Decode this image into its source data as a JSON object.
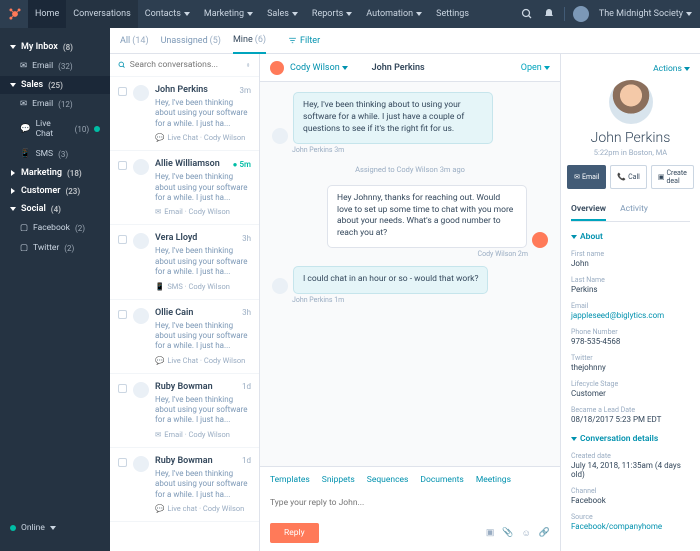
{
  "nav": {
    "home": "Home",
    "conversations": "Conversations",
    "contacts": "Contacts",
    "marketing": "Marketing",
    "sales": "Sales",
    "reports": "Reports",
    "automation": "Automation",
    "settings": "Settings",
    "account": "The Midnight Society"
  },
  "sidebar": {
    "inbox": {
      "label": "My Inbox",
      "count": "(8)",
      "email": {
        "label": "Email",
        "count": "(32)"
      }
    },
    "sales": {
      "label": "Sales",
      "count": "(25)",
      "email": {
        "label": "Email",
        "count": "(12)"
      },
      "chat": {
        "label": "Live Chat",
        "count": "(10)"
      },
      "sms": {
        "label": "SMS",
        "count": "(3)"
      }
    },
    "marketing": {
      "label": "Marketing",
      "count": "(18)"
    },
    "customer": {
      "label": "Customer",
      "count": "(23)"
    },
    "social": {
      "label": "Social",
      "count": "(4)",
      "fb": {
        "label": "Facebook",
        "count": "(2)"
      },
      "tw": {
        "label": "Twitter",
        "count": "(2)"
      }
    },
    "online": "Online"
  },
  "tabs": {
    "all": "All",
    "all_n": "(14)",
    "unassigned": "Unassigned",
    "unassigned_n": "(5)",
    "mine": "Mine",
    "mine_n": "(6)",
    "filter": "Filter"
  },
  "search": {
    "placeholder": "Search conversations..."
  },
  "list": [
    {
      "name": "John Perkins",
      "time": "3m",
      "snip": "Hey, I've been thinking about using your software for a while. I just ha...",
      "src": "Live Chat · Cody Wilson",
      "icon": "chat"
    },
    {
      "name": "Allie Williamson",
      "time": "5m",
      "new": true,
      "snip": "Hey, I've been thinking about using your software for a while. I just ha...",
      "src": "Email · Cody Wilson",
      "icon": "email"
    },
    {
      "name": "Vera Lloyd",
      "time": "3h",
      "snip": "Hey, I've been thinking about using your software for a while. I just ha...",
      "src": "SMS · Cody Wilson",
      "icon": "sms"
    },
    {
      "name": "Ollie Cain",
      "time": "3h",
      "snip": "Hey, I've been thinking about using your software for a while. I just ha...",
      "src": "Live Chat · Cody Wilson",
      "icon": "chat"
    },
    {
      "name": "Ruby Bowman",
      "time": "1d",
      "snip": "Hey, I've been thinking about using your software for a while. I just ha...",
      "src": "Email · Cody Wilson",
      "icon": "email"
    },
    {
      "name": "Ruby Bowman",
      "time": "1d",
      "snip": "Hey, I've been thinking about using your software for a while. I just ha...",
      "src": "Live chat · Cody Wilson",
      "icon": "chat"
    }
  ],
  "thread": {
    "assignee": "Cody Wilson",
    "contact": "John Perkins",
    "status": "Open",
    "msgs": [
      {
        "dir": "in",
        "text": "Hey, I've been thinking about to using your software for a while. I just have a couple of questions to see if it's the right fit for us.",
        "meta": "John Perkins 3m"
      },
      {
        "sys": "Assigned to Cody Wilson 3m ago"
      },
      {
        "dir": "out",
        "text": "Hey Johnny, thanks for reaching out. Would love to set up some time to chat with you more about your needs. What's a good number to reach you at?",
        "meta": "Cody Wilson 2m"
      },
      {
        "dir": "in",
        "text": "I could chat in an hour or so - would that work?",
        "meta": "John Perkins 1m"
      }
    ],
    "reply": {
      "templates": "Templates",
      "snippets": "Snippets",
      "sequences": "Sequences",
      "documents": "Documents",
      "meetings": "Meetings",
      "placeholder": "Type your reply to John...",
      "button": "Reply"
    }
  },
  "detail": {
    "actions": "Actions",
    "name": "John Perkins",
    "sub": "5:22pm in Boston, MA",
    "btns": {
      "email": "Email",
      "call": "Call",
      "deal": "Create deal"
    },
    "tabs": {
      "overview": "Overview",
      "activity": "Activity"
    },
    "about": {
      "title": "About",
      "first": {
        "l": "First name",
        "v": "John"
      },
      "last": {
        "l": "Last Name",
        "v": "Perkins"
      },
      "email": {
        "l": "Email",
        "v": "jappleseed@biglytics.com"
      },
      "phone": {
        "l": "Phone Number",
        "v": "978-535-4568"
      },
      "twitter": {
        "l": "Twitter",
        "v": "thejohnny"
      },
      "stage": {
        "l": "Lifecycle Stage",
        "v": "Customer"
      },
      "lead": {
        "l": "Became a Lead Date",
        "v": "08/18/2017 5:23 PM EDT"
      }
    },
    "conv": {
      "title": "Conversation details",
      "created": {
        "l": "Created date",
        "v": "July 14, 2018, 11:35am (4 days old)"
      },
      "channel": {
        "l": "Channel",
        "v": "Facebook"
      },
      "source": {
        "l": "Source",
        "v": "Facebook/companyhome"
      }
    }
  }
}
